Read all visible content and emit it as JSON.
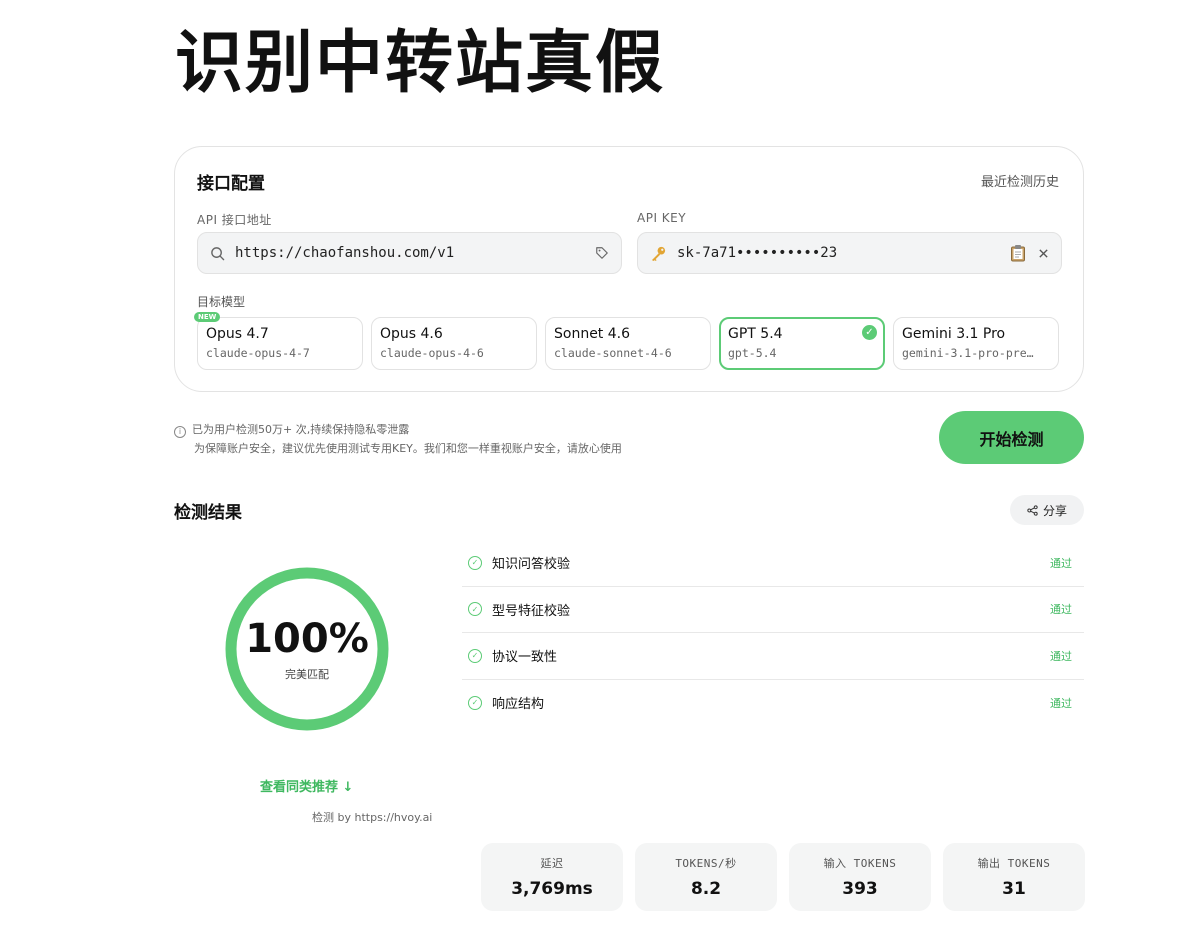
{
  "title": "识别中转站真假",
  "config": {
    "title": "接口配置",
    "history_link": "最近检测历史",
    "api_url_label": "API 接口地址",
    "api_url_value": "https://chaofanshou.com/v1",
    "api_key_label": "API KEY",
    "api_key_value": "sk-7a71••••••••••23",
    "model_label": "目标模型",
    "models": [
      {
        "name": "Opus 4.7",
        "id": "claude-opus-4-7",
        "badge": "NEW"
      },
      {
        "name": "Opus 4.6",
        "id": "claude-opus-4-6"
      },
      {
        "name": "Sonnet 4.6",
        "id": "claude-sonnet-4-6"
      },
      {
        "name": "GPT 5.4",
        "id": "gpt-5.4",
        "selected": true
      },
      {
        "name": "Gemini 3.1 Pro",
        "id": "gemini-3.1-pro-pre…"
      }
    ]
  },
  "notice": {
    "line1": "已为用户检测50万+ 次,持续保持隐私零泄露",
    "line2": "为保障账户安全，建议优先使用测试专用KEY。我们和您一样重视账户安全，请放心使用"
  },
  "start_button": "开始检测",
  "results": {
    "title": "检测结果",
    "share_label": "分享",
    "score": "100%",
    "score_fraction": 1.0,
    "score_label": "完美匹配",
    "recommend_link": "查看同类推荐 ↓",
    "detect_by": "检测 by https://hvoy.ai",
    "checks": [
      {
        "label": "知识问答校验",
        "status": "通过"
      },
      {
        "label": "型号特征校验",
        "status": "通过"
      },
      {
        "label": "协议一致性",
        "status": "通过"
      },
      {
        "label": "响应结构",
        "status": "通过"
      }
    ],
    "stats": [
      {
        "label": "延迟",
        "value": "3,769ms"
      },
      {
        "label": "TOKENS/秒",
        "value": "8.2"
      },
      {
        "label": "输入 TOKENS",
        "value": "393"
      },
      {
        "label": "输出 TOKENS",
        "value": "31"
      }
    ]
  },
  "colors": {
    "accent": "#5ccb76",
    "accent_text": "#3fb860"
  }
}
